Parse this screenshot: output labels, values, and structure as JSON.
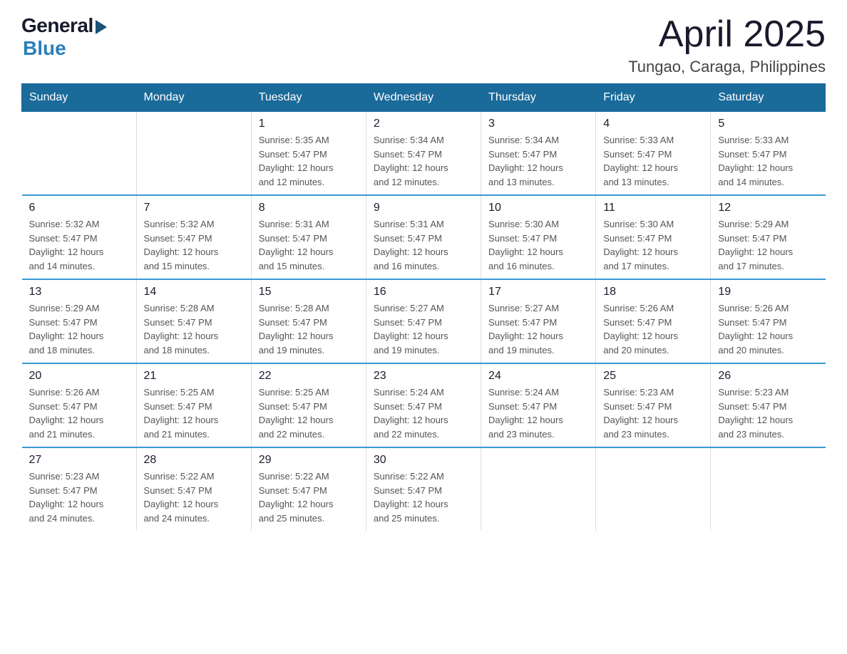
{
  "logo": {
    "general": "General",
    "blue": "Blue"
  },
  "title": "April 2025",
  "subtitle": "Tungao, Caraga, Philippines",
  "weekdays": [
    "Sunday",
    "Monday",
    "Tuesday",
    "Wednesday",
    "Thursday",
    "Friday",
    "Saturday"
  ],
  "weeks": [
    [
      {
        "day": "",
        "info": ""
      },
      {
        "day": "",
        "info": ""
      },
      {
        "day": "1",
        "info": "Sunrise: 5:35 AM\nSunset: 5:47 PM\nDaylight: 12 hours\nand 12 minutes."
      },
      {
        "day": "2",
        "info": "Sunrise: 5:34 AM\nSunset: 5:47 PM\nDaylight: 12 hours\nand 12 minutes."
      },
      {
        "day": "3",
        "info": "Sunrise: 5:34 AM\nSunset: 5:47 PM\nDaylight: 12 hours\nand 13 minutes."
      },
      {
        "day": "4",
        "info": "Sunrise: 5:33 AM\nSunset: 5:47 PM\nDaylight: 12 hours\nand 13 minutes."
      },
      {
        "day": "5",
        "info": "Sunrise: 5:33 AM\nSunset: 5:47 PM\nDaylight: 12 hours\nand 14 minutes."
      }
    ],
    [
      {
        "day": "6",
        "info": "Sunrise: 5:32 AM\nSunset: 5:47 PM\nDaylight: 12 hours\nand 14 minutes."
      },
      {
        "day": "7",
        "info": "Sunrise: 5:32 AM\nSunset: 5:47 PM\nDaylight: 12 hours\nand 15 minutes."
      },
      {
        "day": "8",
        "info": "Sunrise: 5:31 AM\nSunset: 5:47 PM\nDaylight: 12 hours\nand 15 minutes."
      },
      {
        "day": "9",
        "info": "Sunrise: 5:31 AM\nSunset: 5:47 PM\nDaylight: 12 hours\nand 16 minutes."
      },
      {
        "day": "10",
        "info": "Sunrise: 5:30 AM\nSunset: 5:47 PM\nDaylight: 12 hours\nand 16 minutes."
      },
      {
        "day": "11",
        "info": "Sunrise: 5:30 AM\nSunset: 5:47 PM\nDaylight: 12 hours\nand 17 minutes."
      },
      {
        "day": "12",
        "info": "Sunrise: 5:29 AM\nSunset: 5:47 PM\nDaylight: 12 hours\nand 17 minutes."
      }
    ],
    [
      {
        "day": "13",
        "info": "Sunrise: 5:29 AM\nSunset: 5:47 PM\nDaylight: 12 hours\nand 18 minutes."
      },
      {
        "day": "14",
        "info": "Sunrise: 5:28 AM\nSunset: 5:47 PM\nDaylight: 12 hours\nand 18 minutes."
      },
      {
        "day": "15",
        "info": "Sunrise: 5:28 AM\nSunset: 5:47 PM\nDaylight: 12 hours\nand 19 minutes."
      },
      {
        "day": "16",
        "info": "Sunrise: 5:27 AM\nSunset: 5:47 PM\nDaylight: 12 hours\nand 19 minutes."
      },
      {
        "day": "17",
        "info": "Sunrise: 5:27 AM\nSunset: 5:47 PM\nDaylight: 12 hours\nand 19 minutes."
      },
      {
        "day": "18",
        "info": "Sunrise: 5:26 AM\nSunset: 5:47 PM\nDaylight: 12 hours\nand 20 minutes."
      },
      {
        "day": "19",
        "info": "Sunrise: 5:26 AM\nSunset: 5:47 PM\nDaylight: 12 hours\nand 20 minutes."
      }
    ],
    [
      {
        "day": "20",
        "info": "Sunrise: 5:26 AM\nSunset: 5:47 PM\nDaylight: 12 hours\nand 21 minutes."
      },
      {
        "day": "21",
        "info": "Sunrise: 5:25 AM\nSunset: 5:47 PM\nDaylight: 12 hours\nand 21 minutes."
      },
      {
        "day": "22",
        "info": "Sunrise: 5:25 AM\nSunset: 5:47 PM\nDaylight: 12 hours\nand 22 minutes."
      },
      {
        "day": "23",
        "info": "Sunrise: 5:24 AM\nSunset: 5:47 PM\nDaylight: 12 hours\nand 22 minutes."
      },
      {
        "day": "24",
        "info": "Sunrise: 5:24 AM\nSunset: 5:47 PM\nDaylight: 12 hours\nand 23 minutes."
      },
      {
        "day": "25",
        "info": "Sunrise: 5:23 AM\nSunset: 5:47 PM\nDaylight: 12 hours\nand 23 minutes."
      },
      {
        "day": "26",
        "info": "Sunrise: 5:23 AM\nSunset: 5:47 PM\nDaylight: 12 hours\nand 23 minutes."
      }
    ],
    [
      {
        "day": "27",
        "info": "Sunrise: 5:23 AM\nSunset: 5:47 PM\nDaylight: 12 hours\nand 24 minutes."
      },
      {
        "day": "28",
        "info": "Sunrise: 5:22 AM\nSunset: 5:47 PM\nDaylight: 12 hours\nand 24 minutes."
      },
      {
        "day": "29",
        "info": "Sunrise: 5:22 AM\nSunset: 5:47 PM\nDaylight: 12 hours\nand 25 minutes."
      },
      {
        "day": "30",
        "info": "Sunrise: 5:22 AM\nSunset: 5:47 PM\nDaylight: 12 hours\nand 25 minutes."
      },
      {
        "day": "",
        "info": ""
      },
      {
        "day": "",
        "info": ""
      },
      {
        "day": "",
        "info": ""
      }
    ]
  ]
}
